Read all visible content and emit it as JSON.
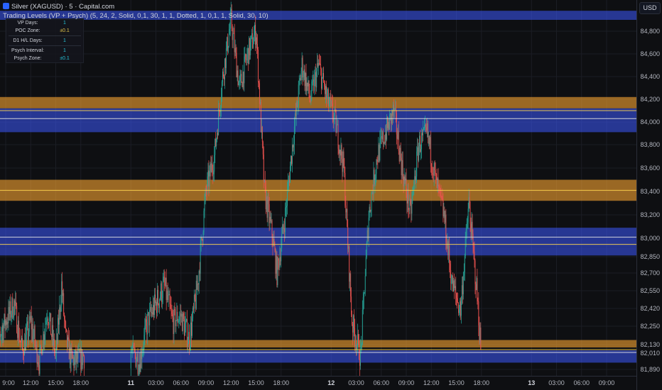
{
  "header": {
    "symbol_line": "Silver (XAGUSD) · 5 · Capital.com",
    "indicator_line": "Trading Levels (VP + Psych) (5, 24, 2, Solid, 0,1, 30, 1, 1, Dotted, 1, 0,1, 1, Solid, 30, 10)"
  },
  "currency": "USD",
  "info_table": [
    {
      "key": "VP Days:",
      "value": "1",
      "color": "#26c6da"
    },
    {
      "key": "POC Zone:",
      "value": "±0.1",
      "color": "#e6c84a"
    },
    {
      "key": "D1 H/L Days:",
      "value": "1",
      "color": "#26c6da"
    },
    {
      "key": "Psych Interval:",
      "value": "1",
      "color": "#26c6da"
    },
    {
      "key": "Psych Zone:",
      "value": "±0.1",
      "color": "#26c6da"
    }
  ],
  "colors": {
    "up": "#26a69a",
    "down": "#ef5350",
    "orange_zone": "#f0a030",
    "blue_zone": "#3d5afe",
    "line_yellow": "#ffd54f",
    "line_white": "#e0e0e0"
  },
  "chart_data": {
    "type": "candlestick",
    "interval": "5",
    "y_ticks": [
      {
        "label": "84,800",
        "value": 84.8
      },
      {
        "label": "84,600",
        "value": 84.6
      },
      {
        "label": "84,400",
        "value": 84.4
      },
      {
        "label": "84,200",
        "value": 84.2
      },
      {
        "label": "84,000",
        "value": 84.0
      },
      {
        "label": "83,800",
        "value": 83.8
      },
      {
        "label": "83,600",
        "value": 83.6
      },
      {
        "label": "83,400",
        "value": 83.4
      },
      {
        "label": "83,200",
        "value": 83.2
      },
      {
        "label": "83,000",
        "value": 83.0
      },
      {
        "label": "82,850",
        "value": 82.85
      },
      {
        "label": "82,700",
        "value": 82.7
      },
      {
        "label": "82,550",
        "value": 82.55
      },
      {
        "label": "82,420",
        "value": 82.42
      },
      {
        "label": "82,250",
        "value": 82.25
      },
      {
        "label": "82,130",
        "value": 82.13
      },
      {
        "label": "82,010",
        "value": 82.01
      },
      {
        "label": "81,890",
        "value": 81.89
      }
    ],
    "x_ticks": [
      {
        "label": "9:00",
        "hours": 0,
        "day": false
      },
      {
        "label": "12:00",
        "hours": 3,
        "day": false
      },
      {
        "label": "15:00",
        "hours": 6,
        "day": false
      },
      {
        "label": "18:00",
        "hours": 9,
        "day": false
      },
      {
        "label": "11",
        "hours": 15,
        "day": true
      },
      {
        "label": "03:00",
        "hours": 18,
        "day": false
      },
      {
        "label": "06:00",
        "hours": 21,
        "day": false
      },
      {
        "label": "09:00",
        "hours": 24,
        "day": false
      },
      {
        "label": "12:00",
        "hours": 27,
        "day": false
      },
      {
        "label": "15:00",
        "hours": 30,
        "day": false
      },
      {
        "label": "18:00",
        "hours": 33,
        "day": false
      },
      {
        "label": "12",
        "hours": 39,
        "day": true
      },
      {
        "label": "03:00",
        "hours": 42,
        "day": false
      },
      {
        "label": "06:00",
        "hours": 45,
        "day": false
      },
      {
        "label": "09:00",
        "hours": 48,
        "day": false
      },
      {
        "label": "12:00",
        "hours": 51,
        "day": false
      },
      {
        "label": "15:00",
        "hours": 54,
        "day": false
      },
      {
        "label": "18:00",
        "hours": 57,
        "day": false
      },
      {
        "label": "13",
        "hours": 63,
        "day": true
      },
      {
        "label": "03:00",
        "hours": 66,
        "day": false
      },
      {
        "label": "06:00",
        "hours": 69,
        "day": false
      },
      {
        "label": "09:00",
        "hours": 72,
        "day": false
      }
    ],
    "zones": [
      {
        "color": "blue",
        "y_top": 84.98,
        "y_bottom": 84.9
      },
      {
        "color": "orange",
        "y_top": 84.22,
        "y_bottom": 84.12
      },
      {
        "color": "blue",
        "y_top": 84.12,
        "y_bottom": 84.01
      },
      {
        "color": "blue",
        "y_top": 84.01,
        "y_bottom": 83.91
      },
      {
        "color": "orange",
        "y_top": 83.5,
        "y_bottom": 83.32
      },
      {
        "color": "blue",
        "y_top": 83.09,
        "y_bottom": 83.02
      },
      {
        "color": "blue",
        "y_top": 83.02,
        "y_bottom": 82.93
      },
      {
        "color": "blue",
        "y_top": 82.93,
        "y_bottom": 82.86
      },
      {
        "color": "orange",
        "y_top": 82.16,
        "y_bottom": 82.09
      },
      {
        "color": "blue",
        "y_top": 82.05,
        "y_bottom": 81.94
      }
    ],
    "lines": [
      {
        "color": "yellow",
        "y": 84.1
      },
      {
        "color": "white",
        "y": 84.03
      },
      {
        "color": "yellow",
        "y": 83.41
      },
      {
        "color": "white",
        "y": 83.01
      },
      {
        "color": "yellow",
        "y": 82.95
      },
      {
        "color": "yellow",
        "y": 82.06
      },
      {
        "color": "white",
        "y": 82.02
      }
    ],
    "price_path": [
      {
        "hours": -1.5,
        "price": 82.1
      },
      {
        "hours": 0,
        "price": 82.3
      },
      {
        "hours": 1,
        "price": 82.45
      },
      {
        "hours": 2,
        "price": 82.05
      },
      {
        "hours": 3,
        "price": 82.3
      },
      {
        "hours": 4,
        "price": 81.95
      },
      {
        "hours": 5,
        "price": 82.4
      },
      {
        "hours": 6,
        "price": 82.0
      },
      {
        "hours": 6.7,
        "price": 82.6
      },
      {
        "hours": 7.2,
        "price": 82.15
      },
      {
        "hours": 8,
        "price": 81.95
      },
      {
        "hours": 9.5,
        "price": 82.0
      },
      {
        "hours": 15,
        "price": 82.05
      },
      {
        "hours": 16,
        "price": 81.95
      },
      {
        "hours": 17,
        "price": 82.3
      },
      {
        "hours": 18,
        "price": 82.45
      },
      {
        "hours": 19,
        "price": 82.6
      },
      {
        "hours": 20,
        "price": 82.3
      },
      {
        "hours": 21,
        "price": 82.35
      },
      {
        "hours": 22,
        "price": 82.15
      },
      {
        "hours": 23,
        "price": 82.6
      },
      {
        "hours": 24,
        "price": 83.4
      },
      {
        "hours": 25,
        "price": 83.7
      },
      {
        "hours": 26,
        "price": 84.4
      },
      {
        "hours": 27,
        "price": 84.9
      },
      {
        "hours": 28,
        "price": 84.3
      },
      {
        "hours": 29,
        "price": 84.6
      },
      {
        "hours": 30,
        "price": 84.8
      },
      {
        "hours": 31,
        "price": 83.4
      },
      {
        "hours": 32,
        "price": 83.0
      },
      {
        "hours": 32.5,
        "price": 82.7
      },
      {
        "hours": 33.5,
        "price": 83.2
      },
      {
        "hours": 34.5,
        "price": 83.9
      },
      {
        "hours": 35.5,
        "price": 84.5
      },
      {
        "hours": 36.5,
        "price": 84.2
      },
      {
        "hours": 37.5,
        "price": 84.5
      },
      {
        "hours": 38.5,
        "price": 84.2
      },
      {
        "hours": 39.5,
        "price": 84.0
      },
      {
        "hours": 40.5,
        "price": 83.6
      },
      {
        "hours": 41.5,
        "price": 82.3
      },
      {
        "hours": 42.5,
        "price": 82.0
      },
      {
        "hours": 43.5,
        "price": 83.2
      },
      {
        "hours": 44.5,
        "price": 83.7
      },
      {
        "hours": 45.5,
        "price": 83.9
      },
      {
        "hours": 46.5,
        "price": 84.1
      },
      {
        "hours": 47.5,
        "price": 83.6
      },
      {
        "hours": 48.5,
        "price": 83.2
      },
      {
        "hours": 49.5,
        "price": 83.8
      },
      {
        "hours": 50.5,
        "price": 83.9
      },
      {
        "hours": 51.5,
        "price": 83.5
      },
      {
        "hours": 52.5,
        "price": 83.2
      },
      {
        "hours": 53.5,
        "price": 82.6
      },
      {
        "hours": 54.5,
        "price": 82.4
      },
      {
        "hours": 55.5,
        "price": 83.3
      },
      {
        "hours": 56.5,
        "price": 82.5
      },
      {
        "hours": 57,
        "price": 82.0
      }
    ]
  }
}
